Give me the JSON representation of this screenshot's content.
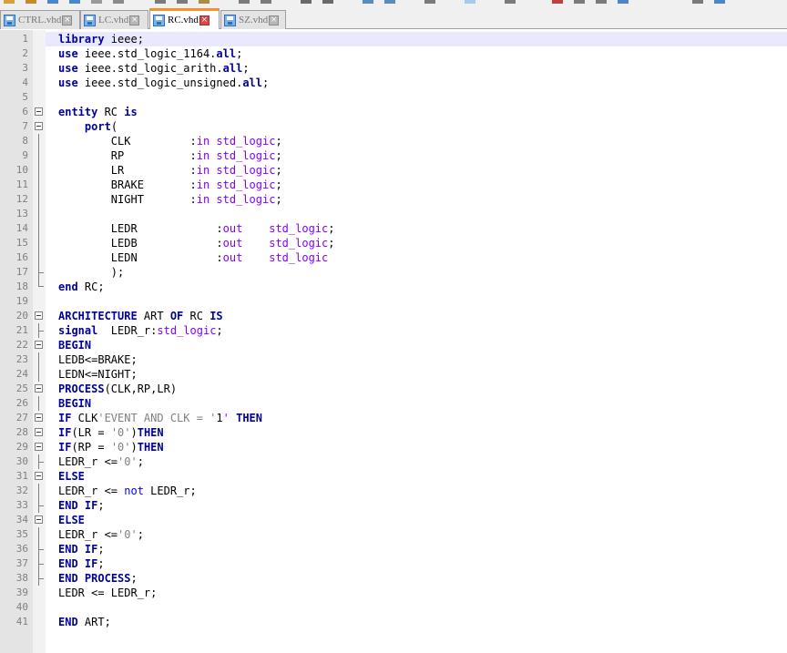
{
  "tabs": [
    {
      "label": "CTRL.vhd",
      "active": false
    },
    {
      "label": "LC.vhd",
      "active": false
    },
    {
      "label": "RC.vhd",
      "active": true
    },
    {
      "label": "SZ.vhd",
      "active": false
    }
  ],
  "close_glyph": "×",
  "colors": {
    "keyword": "#0000a0",
    "type": "#8000ff",
    "string": "#808080",
    "line_numbers": "#808080",
    "gutter": "#e4e4e4",
    "active_tab_accent": "#fa8e2e",
    "current_line": "#e8e8ff"
  },
  "lines": [
    {
      "n": "1",
      "code": "library ieee;"
    },
    {
      "n": "2",
      "code": "use ieee.std_logic_1164.all;"
    },
    {
      "n": "3",
      "code": "use ieee.std_logic_arith.all;"
    },
    {
      "n": "4",
      "code": "use ieee.std_logic_unsigned.all;"
    },
    {
      "n": "5",
      "code": ""
    },
    {
      "n": "6",
      "code": "entity RC is"
    },
    {
      "n": "7",
      "code": "    port("
    },
    {
      "n": "8",
      "code": "        CLK         :in std_logic;"
    },
    {
      "n": "9",
      "code": "        RP          :in std_logic;"
    },
    {
      "n": "10",
      "code": "        LR          :in std_logic;"
    },
    {
      "n": "11",
      "code": "        BRAKE       :in std_logic;"
    },
    {
      "n": "12",
      "code": "        NIGHT       :in std_logic;"
    },
    {
      "n": "13",
      "code": ""
    },
    {
      "n": "14",
      "code": "        LEDR            :out    std_logic;"
    },
    {
      "n": "15",
      "code": "        LEDB            :out    std_logic;"
    },
    {
      "n": "16",
      "code": "        LEDN            :out    std_logic"
    },
    {
      "n": "17",
      "code": "        );"
    },
    {
      "n": "18",
      "code": "end RC;"
    },
    {
      "n": "19",
      "code": ""
    },
    {
      "n": "20",
      "code": "ARCHITECTURE ART OF RC IS"
    },
    {
      "n": "21",
      "code": "signal  LEDR_r:std_logic;"
    },
    {
      "n": "22",
      "code": "BEGIN"
    },
    {
      "n": "23",
      "code": "LEDB<=BRAKE;"
    },
    {
      "n": "24",
      "code": "LEDN<=NIGHT;"
    },
    {
      "n": "25",
      "code": "PROCESS(CLK,RP,LR)"
    },
    {
      "n": "26",
      "code": "BEGIN"
    },
    {
      "n": "27",
      "code": "IF CLK'EVENT AND CLK = '1' THEN"
    },
    {
      "n": "28",
      "code": "IF(LR = '0')THEN"
    },
    {
      "n": "29",
      "code": "IF(RP = '0')THEN"
    },
    {
      "n": "30",
      "code": "LEDR_r <='0';"
    },
    {
      "n": "31",
      "code": "ELSE"
    },
    {
      "n": "32",
      "code": "LEDR_r <= not LEDR_r;"
    },
    {
      "n": "33",
      "code": "END IF;"
    },
    {
      "n": "34",
      "code": "ELSE"
    },
    {
      "n": "35",
      "code": "LEDR_r <='0';"
    },
    {
      "n": "36",
      "code": "END IF;"
    },
    {
      "n": "37",
      "code": "END IF;"
    },
    {
      "n": "38",
      "code": "END PROCESS;"
    },
    {
      "n": "39",
      "code": "LEDR <= LEDR_r;"
    },
    {
      "n": "40",
      "code": ""
    },
    {
      "n": "41",
      "code": "END ART;"
    }
  ]
}
